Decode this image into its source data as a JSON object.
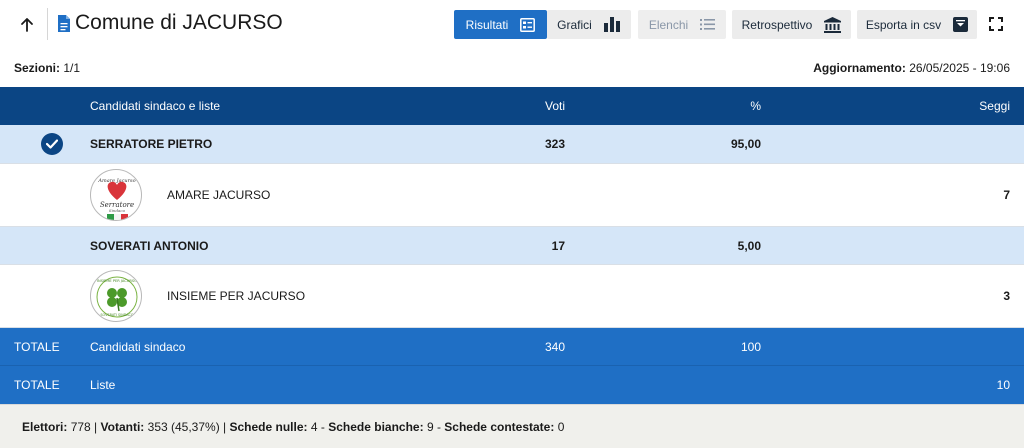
{
  "header": {
    "title": "Comune di JACURSO",
    "buttons": {
      "risultati": "Risultati",
      "grafici": "Grafici",
      "elenchi": "Elenchi",
      "retrospettivo": "Retrospettivo",
      "esporta": "Esporta in csv"
    }
  },
  "meta": {
    "sezioni_label": "Sezioni:",
    "sezioni_value": "1/1",
    "aggiornamento_label": "Aggiornamento:",
    "aggiornamento_value": "26/05/2025 - 19:06"
  },
  "table": {
    "columns": {
      "name": "Candidati sindaco e liste",
      "voti": "Voti",
      "perc": "%",
      "seggi": "Seggi"
    },
    "candidates": [
      {
        "name": "SERRATORE PIETRO",
        "voti": "323",
        "perc": "95,00",
        "elected": true,
        "list": {
          "name": "AMARE JACURSO",
          "seggi": "7",
          "logo_text_top": "Amare Jacurso",
          "logo_text_mid": "Serratore",
          "logo_text_bot": "Sindaco"
        }
      },
      {
        "name": "SOVERATI ANTONIO",
        "voti": "17",
        "perc": "5,00",
        "elected": false,
        "list": {
          "name": "INSIEME PER JACURSO",
          "seggi": "3",
          "logo_text_top": "INSIEME PER JACURSO",
          "logo_text_bot": "SOVERATI SINDACO"
        }
      }
    ],
    "totals": [
      {
        "label": "TOTALE",
        "name": "Candidati sindaco",
        "voti": "340",
        "perc": "100",
        "seggi": ""
      },
      {
        "label": "TOTALE",
        "name": "Liste",
        "voti": "",
        "perc": "",
        "seggi": "10"
      }
    ]
  },
  "footer": {
    "elettori_label": "Elettori:",
    "elettori_value": "778",
    "votanti_label": "Votanti:",
    "votanti_value": "353 (45,37%)",
    "nulle_label": "Schede nulle:",
    "nulle_value": "4",
    "bianche_label": "Schede bianche:",
    "bianche_value": "9",
    "contestate_label": "Schede contestate:",
    "contestate_value": "0"
  },
  "colors": {
    "header_bg": "#0b4584",
    "primary": "#1f6fc5",
    "candidate_row": "#d5e6f8",
    "footer_bg": "#f0f0ec"
  },
  "icons": {
    "back": "arrow-up-icon",
    "doc": "document-icon",
    "risultati": "list-card-icon",
    "grafici": "bar-chart-icon",
    "elenchi": "list-icon",
    "retrospettivo": "bank-icon",
    "esporta": "download-box-icon",
    "fullscreen": "fullscreen-icon",
    "elected": "check-circle-icon"
  }
}
